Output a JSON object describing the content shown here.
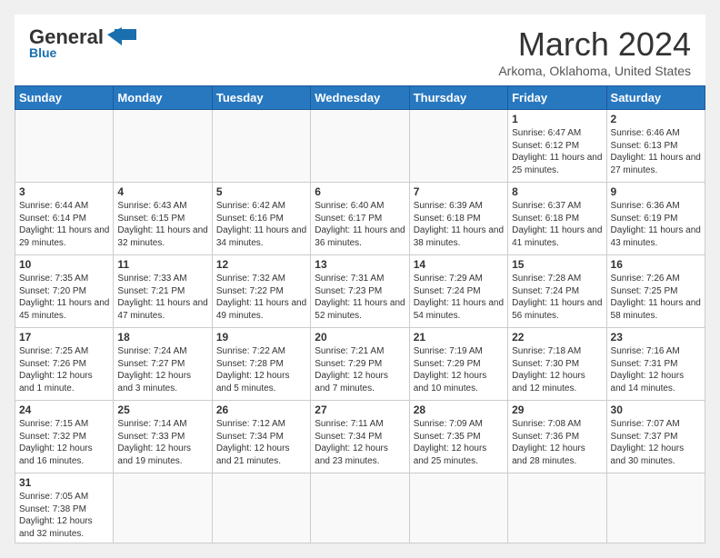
{
  "header": {
    "logo_general": "General",
    "logo_blue": "Blue",
    "month_year": "March 2024",
    "location": "Arkoma, Oklahoma, United States"
  },
  "weekdays": [
    "Sunday",
    "Monday",
    "Tuesday",
    "Wednesday",
    "Thursday",
    "Friday",
    "Saturday"
  ],
  "weeks": [
    [
      {
        "day": "",
        "info": ""
      },
      {
        "day": "",
        "info": ""
      },
      {
        "day": "",
        "info": ""
      },
      {
        "day": "",
        "info": ""
      },
      {
        "day": "",
        "info": ""
      },
      {
        "day": "1",
        "info": "Sunrise: 6:47 AM\nSunset: 6:12 PM\nDaylight: 11 hours\nand 25 minutes."
      },
      {
        "day": "2",
        "info": "Sunrise: 6:46 AM\nSunset: 6:13 PM\nDaylight: 11 hours\nand 27 minutes."
      }
    ],
    [
      {
        "day": "3",
        "info": "Sunrise: 6:44 AM\nSunset: 6:14 PM\nDaylight: 11 hours\nand 29 minutes."
      },
      {
        "day": "4",
        "info": "Sunrise: 6:43 AM\nSunset: 6:15 PM\nDaylight: 11 hours\nand 32 minutes."
      },
      {
        "day": "5",
        "info": "Sunrise: 6:42 AM\nSunset: 6:16 PM\nDaylight: 11 hours\nand 34 minutes."
      },
      {
        "day": "6",
        "info": "Sunrise: 6:40 AM\nSunset: 6:17 PM\nDaylight: 11 hours\nand 36 minutes."
      },
      {
        "day": "7",
        "info": "Sunrise: 6:39 AM\nSunset: 6:18 PM\nDaylight: 11 hours\nand 38 minutes."
      },
      {
        "day": "8",
        "info": "Sunrise: 6:37 AM\nSunset: 6:18 PM\nDaylight: 11 hours\nand 41 minutes."
      },
      {
        "day": "9",
        "info": "Sunrise: 6:36 AM\nSunset: 6:19 PM\nDaylight: 11 hours\nand 43 minutes."
      }
    ],
    [
      {
        "day": "10",
        "info": "Sunrise: 7:35 AM\nSunset: 7:20 PM\nDaylight: 11 hours\nand 45 minutes."
      },
      {
        "day": "11",
        "info": "Sunrise: 7:33 AM\nSunset: 7:21 PM\nDaylight: 11 hours\nand 47 minutes."
      },
      {
        "day": "12",
        "info": "Sunrise: 7:32 AM\nSunset: 7:22 PM\nDaylight: 11 hours\nand 49 minutes."
      },
      {
        "day": "13",
        "info": "Sunrise: 7:31 AM\nSunset: 7:23 PM\nDaylight: 11 hours\nand 52 minutes."
      },
      {
        "day": "14",
        "info": "Sunrise: 7:29 AM\nSunset: 7:24 PM\nDaylight: 11 hours\nand 54 minutes."
      },
      {
        "day": "15",
        "info": "Sunrise: 7:28 AM\nSunset: 7:24 PM\nDaylight: 11 hours\nand 56 minutes."
      },
      {
        "day": "16",
        "info": "Sunrise: 7:26 AM\nSunset: 7:25 PM\nDaylight: 11 hours\nand 58 minutes."
      }
    ],
    [
      {
        "day": "17",
        "info": "Sunrise: 7:25 AM\nSunset: 7:26 PM\nDaylight: 12 hours\nand 1 minute."
      },
      {
        "day": "18",
        "info": "Sunrise: 7:24 AM\nSunset: 7:27 PM\nDaylight: 12 hours\nand 3 minutes."
      },
      {
        "day": "19",
        "info": "Sunrise: 7:22 AM\nSunset: 7:28 PM\nDaylight: 12 hours\nand 5 minutes."
      },
      {
        "day": "20",
        "info": "Sunrise: 7:21 AM\nSunset: 7:29 PM\nDaylight: 12 hours\nand 7 minutes."
      },
      {
        "day": "21",
        "info": "Sunrise: 7:19 AM\nSunset: 7:29 PM\nDaylight: 12 hours\nand 10 minutes."
      },
      {
        "day": "22",
        "info": "Sunrise: 7:18 AM\nSunset: 7:30 PM\nDaylight: 12 hours\nand 12 minutes."
      },
      {
        "day": "23",
        "info": "Sunrise: 7:16 AM\nSunset: 7:31 PM\nDaylight: 12 hours\nand 14 minutes."
      }
    ],
    [
      {
        "day": "24",
        "info": "Sunrise: 7:15 AM\nSunset: 7:32 PM\nDaylight: 12 hours\nand 16 minutes."
      },
      {
        "day": "25",
        "info": "Sunrise: 7:14 AM\nSunset: 7:33 PM\nDaylight: 12 hours\nand 19 minutes."
      },
      {
        "day": "26",
        "info": "Sunrise: 7:12 AM\nSunset: 7:34 PM\nDaylight: 12 hours\nand 21 minutes."
      },
      {
        "day": "27",
        "info": "Sunrise: 7:11 AM\nSunset: 7:34 PM\nDaylight: 12 hours\nand 23 minutes."
      },
      {
        "day": "28",
        "info": "Sunrise: 7:09 AM\nSunset: 7:35 PM\nDaylight: 12 hours\nand 25 minutes."
      },
      {
        "day": "29",
        "info": "Sunrise: 7:08 AM\nSunset: 7:36 PM\nDaylight: 12 hours\nand 28 minutes."
      },
      {
        "day": "30",
        "info": "Sunrise: 7:07 AM\nSunset: 7:37 PM\nDaylight: 12 hours\nand 30 minutes."
      }
    ],
    [
      {
        "day": "31",
        "info": "Sunrise: 7:05 AM\nSunset: 7:38 PM\nDaylight: 12 hours\nand 32 minutes."
      },
      {
        "day": "",
        "info": ""
      },
      {
        "day": "",
        "info": ""
      },
      {
        "day": "",
        "info": ""
      },
      {
        "day": "",
        "info": ""
      },
      {
        "day": "",
        "info": ""
      },
      {
        "day": "",
        "info": ""
      }
    ]
  ]
}
